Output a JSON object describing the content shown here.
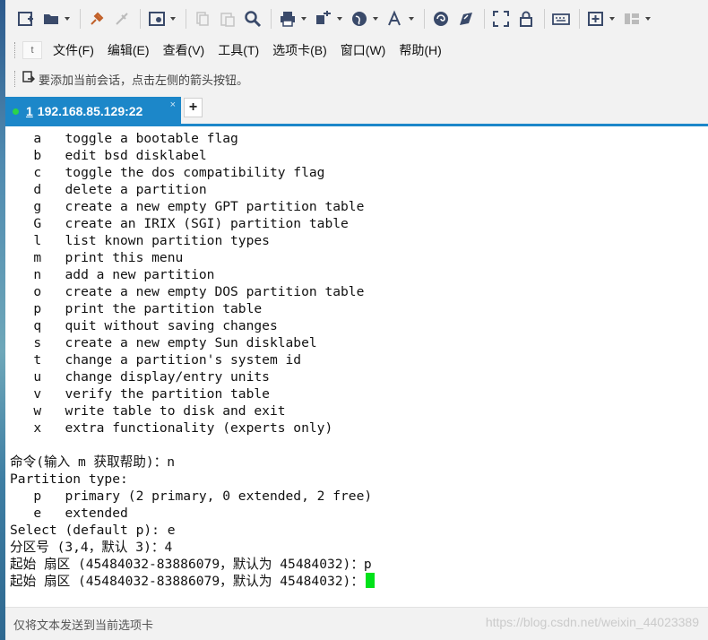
{
  "toolbar": {
    "buttons": [
      "new-session-icon",
      "open-folder-icon",
      "connect-icon",
      "disconnect-icon",
      "settings-icon",
      "copy-icon",
      "paste-icon",
      "find-icon",
      "print-icon",
      "transfer-icon",
      "globe-icon",
      "font-icon",
      "script-icon",
      "xftp-icon",
      "fullscreen-icon",
      "lock-icon",
      "keyboard-icon",
      "add-pane-icon",
      "layout-icon"
    ]
  },
  "menu": {
    "icon_text": "t",
    "items": [
      "文件(F)",
      "编辑(E)",
      "查看(V)",
      "工具(T)",
      "选项卡(B)",
      "窗口(W)",
      "帮助(H)"
    ]
  },
  "hint": "要添加当前会话，点击左侧的箭头按钮。",
  "tab": {
    "number": "1",
    "label": "192.168.85.129:22",
    "close": "×",
    "add": "+",
    "status_color": "#2bd34a"
  },
  "terminal": {
    "lines": [
      "   a   toggle a bootable flag",
      "   b   edit bsd disklabel",
      "   c   toggle the dos compatibility flag",
      "   d   delete a partition",
      "   g   create a new empty GPT partition table",
      "   G   create an IRIX (SGI) partition table",
      "   l   list known partition types",
      "   m   print this menu",
      "   n   add a new partition",
      "   o   create a new empty DOS partition table",
      "   p   print the partition table",
      "   q   quit without saving changes",
      "   s   create a new empty Sun disklabel",
      "   t   change a partition's system id",
      "   u   change display/entry units",
      "   v   verify the partition table",
      "   w   write table to disk and exit",
      "   x   extra functionality (experts only)",
      "",
      "命令(输入 m 获取帮助)：n",
      "Partition type:",
      "   p   primary (2 primary, 0 extended, 2 free)",
      "   e   extended",
      "Select (default p): e",
      "分区号 (3,4，默认 3)：4",
      "起始 扇区 (45484032-83886079，默认为 45484032)：p"
    ],
    "prompt": "起始 扇区 (45484032-83886079，默认为 45484032)：",
    "cursor_color": "#00e21a"
  },
  "status": {
    "text": "仅将文本发送到当前选项卡",
    "watermark": "https://blog.csdn.net/weixin_44023389"
  }
}
